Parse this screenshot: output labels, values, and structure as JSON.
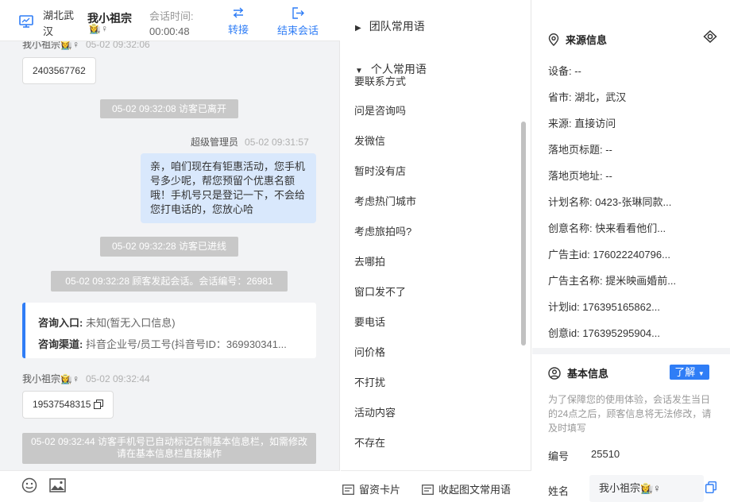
{
  "header": {
    "location": "湖北武汉",
    "visitor_name": "我小祖宗",
    "visitor_sex": "👩‍🌾♀",
    "session_time_label": "会话时间:",
    "session_time": "00:00:48",
    "transfer_label": "转接",
    "end_label": "结束会话",
    "accent": "#2f7df6"
  },
  "chat": {
    "msg1": {
      "sender": "我小祖宗👩‍🌾♀",
      "time": "05-02 09:32:06",
      "text": "2403567762"
    },
    "sys1": "05-02 09:32:08 访客已离开",
    "agent_msg": {
      "sender": "超级管理员",
      "time": "05-02 09:31:57",
      "text": "亲，咱们现在有钜惠活动，您手机号多少呢，帮您预留个优惠名额哦！手机号只是登记一下，不会给您打电话的，您放心哈"
    },
    "sys2": "05-02 09:32:28 访客已进线",
    "sys3": "05-02 09:32:28 顾客发起会话。会话编号：26981",
    "entry_card": {
      "entry_label": "咨询入口:",
      "entry_value": "未知(暂无入口信息)",
      "channel_label": "咨询渠道:",
      "channel_value": "抖音企业号/员工号(抖音号ID：369930341..."
    },
    "msg2": {
      "sender": "我小祖宗👩‍🌾♀",
      "time": "05-02 09:32:44",
      "text": "19537548315"
    },
    "sys4": "05-02 09:32:44 访客手机号已自动标记右侧基本信息栏，如需修改请在基本信息栏直接操作"
  },
  "phrases": {
    "team_group": "团队常用语",
    "personal_group": "个人常用语",
    "partial_item": "要联系方式",
    "items": [
      "问是咨询吗",
      "发微信",
      "暂时没有店",
      "考虑热门城市",
      "考虑旅拍吗?",
      "去哪拍",
      "窗口发不了",
      "要电话",
      "问价格",
      "不打扰",
      "活动内容",
      "不存在"
    ],
    "bottom_card": "留资卡片",
    "bottom_collapse": "收起图文常用语"
  },
  "source_info": {
    "title": "来源信息",
    "rows": [
      "设备: --",
      "省市: 湖北，武汉",
      "来源: 直接访问",
      "落地页标题: --",
      "落地页地址: --",
      "计划名称: 0423-张琳同款...",
      "创意名称: 快来看看他们...",
      "广告主id: 176022240796...",
      "广告主名称: 提米映画婚前...",
      "计划id: 176395165862...",
      "创意id: 176395295904..."
    ]
  },
  "basic_info": {
    "title": "基本信息",
    "more_label": "了解",
    "note": "为了保障您的使用体验，会话发生当日的24点之后，顾客信息将无法修改，请及时填写",
    "number_label": "编号",
    "number_value": "25510",
    "name_label": "姓名",
    "name_value": "我小祖宗👩‍🌾♀"
  }
}
